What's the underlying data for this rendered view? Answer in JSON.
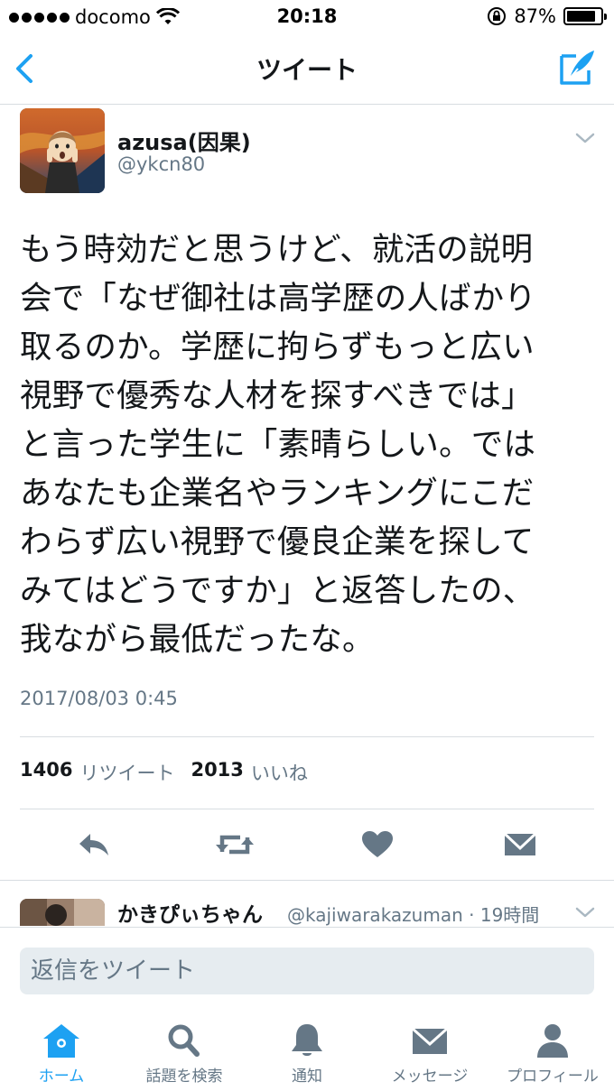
{
  "status_bar": {
    "carrier": "docomo",
    "time": "20:18",
    "battery": "87%",
    "battery_level": 0.87
  },
  "nav": {
    "title": "ツイート",
    "back_icon": "chevron-left-icon",
    "compose_icon": "compose-tweet-icon"
  },
  "tweet": {
    "display_name": "azusa(因果)",
    "handle": "@ykcn80",
    "lines": [
      "もう時効だと思うけど、就活の説明",
      "会で「なぜ御社は高学歴の人ばかり",
      "取るのか。学歴に拘らずもっと広い",
      "視野で優秀な人材を探すべきでは」",
      "と言った学生に「素晴らしい。では",
      "あなたも企業名やランキングにこだ",
      "わらず広い視野で優良企業を探して",
      "みてはどうですか」と返答したの、",
      "我ながら最低だったな。"
    ],
    "timestamp": "2017/08/03 0:45",
    "retweet_count": "1406",
    "retweet_label": "リツイート",
    "like_count": "2013",
    "like_label": "いいね"
  },
  "reply_preview": {
    "display_name": "かきぴぃちゃん",
    "meta": "@kajiwarakazuman · 19時間"
  },
  "composer": {
    "placeholder": "返信をツイート"
  },
  "tabs": [
    {
      "label": "ホーム",
      "icon": "home-icon",
      "active": true
    },
    {
      "label": "話題を検索",
      "icon": "search-icon",
      "active": false
    },
    {
      "label": "通知",
      "icon": "bell-icon",
      "active": false
    },
    {
      "label": "メッセージ",
      "icon": "envelope-icon",
      "active": false
    },
    {
      "label": "プロフィール",
      "icon": "person-icon",
      "active": false
    }
  ],
  "colors": {
    "accent": "#1da1f2",
    "text": "#14171a",
    "secondary": "#657786",
    "divider": "#d8dde1",
    "input_bg": "#e6ecf0"
  }
}
